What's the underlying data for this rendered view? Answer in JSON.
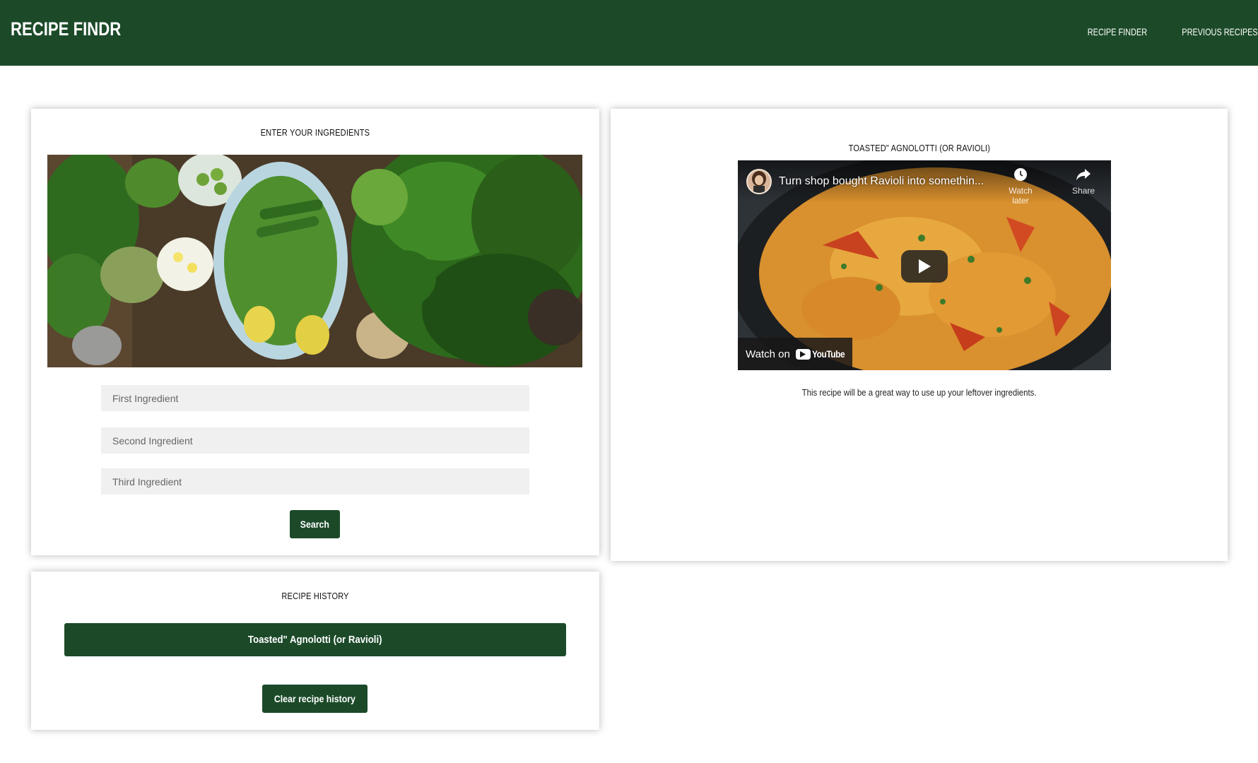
{
  "navbar": {
    "brand": "RECIPE FINDR",
    "links": [
      "RECIPE FINDER",
      "PREVIOUS RECIPES"
    ]
  },
  "ingredients": {
    "title": "ENTER YOUR INGREDIENTS",
    "image_alt": "vegetables",
    "inputs": [
      {
        "placeholder": "First Ingredient",
        "value": ""
      },
      {
        "placeholder": "Second Ingredient",
        "value": ""
      },
      {
        "placeholder": "Third Ingredient",
        "value": ""
      }
    ],
    "search_label": "Search"
  },
  "history": {
    "title": "RECIPE HISTORY",
    "items": [
      "Toasted\" Agnolotti (or Ravioli)"
    ],
    "clear_label": "Clear recipe history"
  },
  "result": {
    "title": "TOASTED\" AGNOLOTTI (OR RAVIOLI)",
    "video": {
      "title": "Turn shop bought Ravioli into somethin...",
      "watch_later": "Watch later",
      "share": "Share",
      "watch_on": "Watch on",
      "youtube": "YouTube"
    },
    "description": "This recipe will be a great way to use up your leftover ingredients."
  },
  "colors": {
    "brand_green": "#1c4a29",
    "input_bg": "#f0f0f0"
  }
}
